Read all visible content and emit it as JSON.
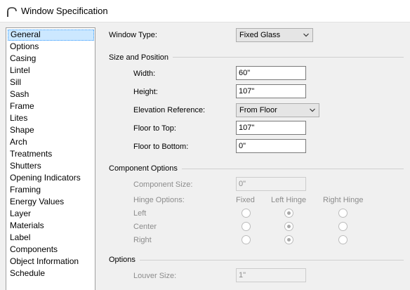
{
  "window": {
    "title": "Window Specification"
  },
  "sidebar": {
    "items": [
      {
        "label": "General",
        "selected": true
      },
      {
        "label": "Options"
      },
      {
        "label": "Casing"
      },
      {
        "label": "Lintel"
      },
      {
        "label": "Sill"
      },
      {
        "label": "Sash"
      },
      {
        "label": "Frame"
      },
      {
        "label": "Lites"
      },
      {
        "label": "Shape"
      },
      {
        "label": "Arch"
      },
      {
        "label": "Treatments"
      },
      {
        "label": "Shutters"
      },
      {
        "label": "Opening Indicators"
      },
      {
        "label": "Framing"
      },
      {
        "label": "Energy Values"
      },
      {
        "label": "Layer"
      },
      {
        "label": "Materials"
      },
      {
        "label": "Label"
      },
      {
        "label": "Components"
      },
      {
        "label": "Object Information"
      },
      {
        "label": "Schedule"
      }
    ]
  },
  "general": {
    "window_type_label": "Window Type:",
    "window_type_value": "Fixed Glass",
    "size_section": "Size and Position",
    "width_label": "Width:",
    "width_value": "60\"",
    "height_label": "Height:",
    "height_value": "107\"",
    "elevation_label": "Elevation Reference:",
    "elevation_value": "From Floor",
    "floor_to_top_label": "Floor to Top:",
    "floor_to_top_value": "107\"",
    "floor_to_bottom_label": "Floor to Bottom:",
    "floor_to_bottom_value": "0\""
  },
  "component": {
    "section": "Component Options",
    "size_label": "Component Size:",
    "size_value": "0\"",
    "hinge_label": "Hinge Options:",
    "col_fixed": "Fixed",
    "col_left": "Left Hinge",
    "col_right": "Right Hinge",
    "row_left": "Left",
    "row_center": "Center",
    "row_right": "Right",
    "selected_column": "Left Hinge"
  },
  "options": {
    "section": "Options",
    "louver_label": "Louver Size:",
    "louver_value": "1\""
  }
}
